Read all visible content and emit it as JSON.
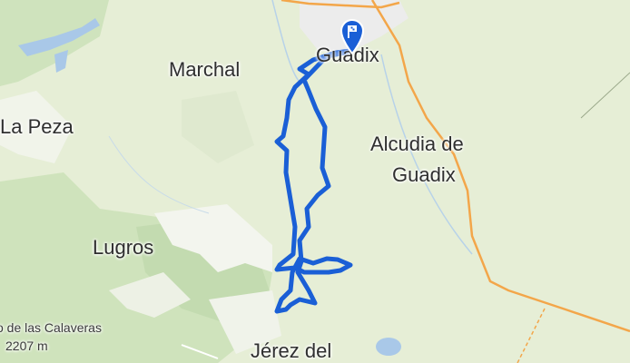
{
  "map": {
    "places": {
      "guadix": "Guadix",
      "marchal": "Marchal",
      "la_peza": "La Peza",
      "alcudia_line1": "Alcudia de",
      "alcudia_line2": "Guadix",
      "lugros": "Lugros",
      "jerez": "Jérez del",
      "calaveras": "o de las Calaveras",
      "calaveras_elev": "2207 m"
    },
    "route_color": "#1a5fd6",
    "marker_color": "#1a5fd6",
    "marker_icon": "finish-flag-icon"
  }
}
